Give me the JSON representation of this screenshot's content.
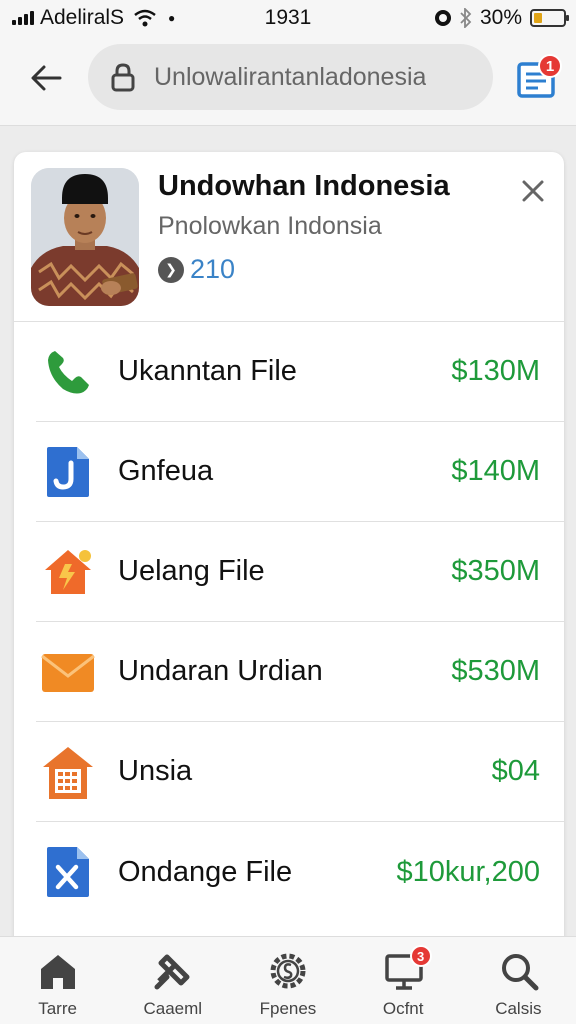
{
  "status_bar": {
    "carrier": "AdeliralS",
    "time": "1931",
    "battery_percent": "30%",
    "battery_level": 0.3
  },
  "browser": {
    "url": "Unlowalirantanladonesia",
    "tabs_badge": "1"
  },
  "profile": {
    "name": "Undowhan Indonesia",
    "subtitle": "Pnolowkan Indonsia",
    "count": "210"
  },
  "rows": [
    {
      "label": "Ukanntan File",
      "value": "$130M",
      "icon": "phone-icon",
      "color": "#2e9b3c"
    },
    {
      "label": "Gnfeua",
      "value": "$140M",
      "icon": "document-j-icon",
      "color": "#2f6fd0"
    },
    {
      "label": "Uelang File",
      "value": "$350M",
      "icon": "house-bolt-icon",
      "color": "#ef6a2a"
    },
    {
      "label": "Undaran Urdian",
      "value": "$530M",
      "icon": "envelope-icon",
      "color": "#f08a24"
    },
    {
      "label": "Unsia",
      "value": "$04",
      "icon": "building-icon",
      "color": "#e8742c"
    },
    {
      "label": "Ondange File",
      "value": "$10kur,200",
      "icon": "document-x-icon",
      "color": "#2f6fd0"
    }
  ],
  "bottom_nav": [
    {
      "label": "Tarre",
      "icon": "home-icon"
    },
    {
      "label": "Caaeml",
      "icon": "tools-icon"
    },
    {
      "label": "Fpenes",
      "icon": "gear-dollar-icon"
    },
    {
      "label": "Ocfnt",
      "icon": "monitor-icon",
      "badge": "3"
    },
    {
      "label": "Calsis",
      "icon": "search-icon"
    }
  ],
  "colors": {
    "accent_green": "#1e9a3a",
    "accent_blue": "#3a83c7",
    "badge_red": "#e53935"
  }
}
